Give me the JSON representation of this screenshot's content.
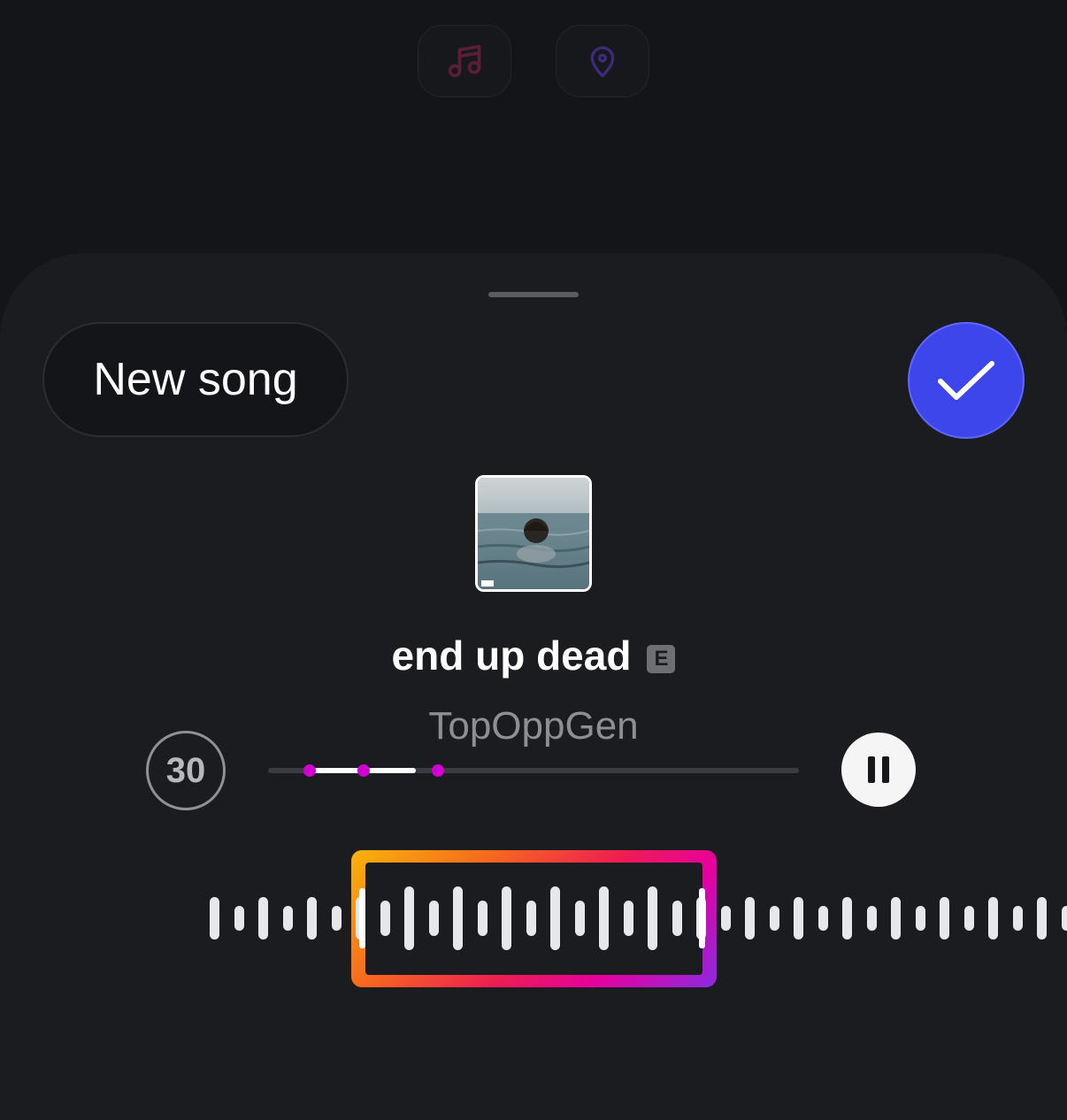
{
  "top_bar": {
    "icons": [
      "music-note-icon",
      "location-pin-icon"
    ]
  },
  "sheet": {
    "new_song_label": "New song",
    "confirm_icon": "checkmark-icon"
  },
  "song": {
    "title": "end up dead",
    "explicit_badge": "E",
    "artist": "TopOppGen"
  },
  "player": {
    "clip_duration": "30",
    "progress": 0.2,
    "control_icon": "pause-icon"
  },
  "colors": {
    "accent_blue": "#3d46ea",
    "selector_gradient": [
      "#f8b40a",
      "#f76b1c",
      "#ee1d52",
      "#e6009e",
      "#8a2be2"
    ],
    "progress_dot": "#d000d0"
  }
}
